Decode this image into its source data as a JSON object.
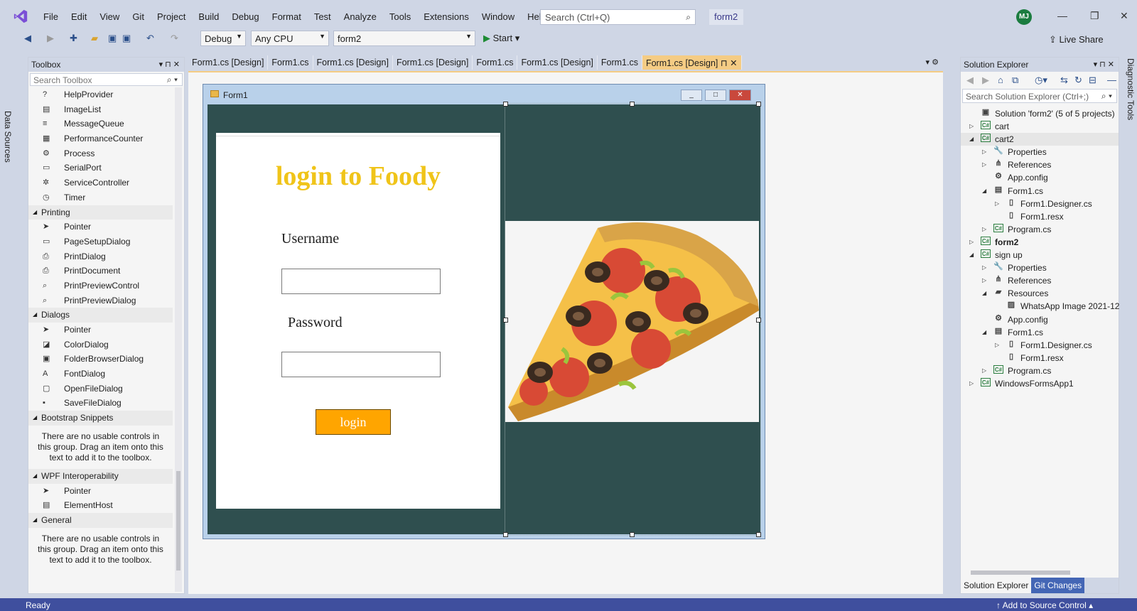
{
  "menu": [
    "File",
    "Edit",
    "View",
    "Git",
    "Project",
    "Build",
    "Debug",
    "Format",
    "Test",
    "Analyze",
    "Tools",
    "Extensions",
    "Window",
    "Help"
  ],
  "search_placeholder": "Search (Ctrl+Q)",
  "solution_badge": "form2",
  "avatar_initials": "MJ",
  "toolbar": {
    "config": "Debug",
    "platform": "Any CPU",
    "startup_project": "form2",
    "start_label": "Start",
    "live_share": "Live Share"
  },
  "left_strip_label": "Data Sources",
  "right_strip_label": "Diagnostic Tools",
  "toolbox": {
    "title": "Toolbox",
    "search_placeholder": "Search Toolbox",
    "items": [
      {
        "kind": "item",
        "label": "HelpProvider",
        "icon": "help-icon"
      },
      {
        "kind": "item",
        "label": "ImageList",
        "icon": "imagelist-icon"
      },
      {
        "kind": "item",
        "label": "MessageQueue",
        "icon": "queue-icon"
      },
      {
        "kind": "item",
        "label": "PerformanceCounter",
        "icon": "counter-icon"
      },
      {
        "kind": "item",
        "label": "Process",
        "icon": "process-icon"
      },
      {
        "kind": "item",
        "label": "SerialPort",
        "icon": "port-icon"
      },
      {
        "kind": "item",
        "label": "ServiceController",
        "icon": "gear-icon"
      },
      {
        "kind": "item",
        "label": "Timer",
        "icon": "timer-icon"
      },
      {
        "kind": "group",
        "label": "Printing"
      },
      {
        "kind": "item",
        "label": "Pointer",
        "icon": "pointer-icon"
      },
      {
        "kind": "item",
        "label": "PageSetupDialog",
        "icon": "page-icon"
      },
      {
        "kind": "item",
        "label": "PrintDialog",
        "icon": "printer-icon"
      },
      {
        "kind": "item",
        "label": "PrintDocument",
        "icon": "printer-icon"
      },
      {
        "kind": "item",
        "label": "PrintPreviewControl",
        "icon": "preview-icon"
      },
      {
        "kind": "item",
        "label": "PrintPreviewDialog",
        "icon": "preview-icon"
      },
      {
        "kind": "group",
        "label": "Dialogs"
      },
      {
        "kind": "item",
        "label": "Pointer",
        "icon": "pointer-icon"
      },
      {
        "kind": "item",
        "label": "ColorDialog",
        "icon": "color-icon"
      },
      {
        "kind": "item",
        "label": "FolderBrowserDialog",
        "icon": "folder-icon"
      },
      {
        "kind": "item",
        "label": "FontDialog",
        "icon": "font-icon"
      },
      {
        "kind": "item",
        "label": "OpenFileDialog",
        "icon": "open-icon"
      },
      {
        "kind": "item",
        "label": "SaveFileDialog",
        "icon": "save-icon"
      },
      {
        "kind": "group",
        "label": "Bootstrap Snippets"
      },
      {
        "kind": "note",
        "label": "There are no usable controls in this group. Drag an item onto this text to add it to the toolbox."
      },
      {
        "kind": "group",
        "label": "WPF Interoperability"
      },
      {
        "kind": "item",
        "label": "Pointer",
        "icon": "pointer-icon"
      },
      {
        "kind": "item",
        "label": "ElementHost",
        "icon": "host-icon"
      },
      {
        "kind": "group",
        "label": "General"
      },
      {
        "kind": "note",
        "label": "There are no usable controls in this group. Drag an item onto this text to add it to the toolbox."
      }
    ]
  },
  "doc_tabs": [
    {
      "label": "Form1.cs [Design]",
      "active": false
    },
    {
      "label": "Form1.cs",
      "active": false
    },
    {
      "label": "Form1.cs [Design]",
      "active": false
    },
    {
      "label": "Form1.cs [Design]",
      "active": false
    },
    {
      "label": "Form1.cs",
      "active": false
    },
    {
      "label": "Form1.cs [Design]",
      "active": false
    },
    {
      "label": "Form1.cs",
      "active": false
    },
    {
      "label": "Form1.cs [Design]",
      "active": true
    }
  ],
  "form": {
    "title": "Form1",
    "heading": "login to Foody",
    "username_label": "Username",
    "password_label": "Password",
    "login_button": "login"
  },
  "solution_explorer": {
    "title": "Solution Explorer",
    "search_placeholder": "Search Solution Explorer (Ctrl+;)",
    "nodes": [
      {
        "label": "Solution 'form2' (5 of 5 projects)",
        "depth": 0,
        "twisty": "",
        "icon": "solution"
      },
      {
        "label": "cart",
        "depth": 0,
        "twisty": "▷",
        "icon": "cs"
      },
      {
        "label": "cart2",
        "depth": 0,
        "twisty": "◢",
        "icon": "cs",
        "selected": true
      },
      {
        "label": "Properties",
        "depth": 1,
        "twisty": "▷",
        "icon": "wrench"
      },
      {
        "label": "References",
        "depth": 1,
        "twisty": "▷",
        "icon": "refs"
      },
      {
        "label": "App.config",
        "depth": 1,
        "twisty": "",
        "icon": "config"
      },
      {
        "label": "Form1.cs",
        "depth": 1,
        "twisty": "◢",
        "icon": "form"
      },
      {
        "label": "Form1.Designer.cs",
        "depth": 2,
        "twisty": "▷",
        "icon": "file"
      },
      {
        "label": "Form1.resx",
        "depth": 2,
        "twisty": "",
        "icon": "file"
      },
      {
        "label": "Program.cs",
        "depth": 1,
        "twisty": "▷",
        "icon": "cs"
      },
      {
        "label": "form2",
        "depth": 0,
        "twisty": "▷",
        "icon": "cs",
        "bold": true
      },
      {
        "label": "sign up",
        "depth": 0,
        "twisty": "◢",
        "icon": "cs"
      },
      {
        "label": "Properties",
        "depth": 1,
        "twisty": "▷",
        "icon": "wrench"
      },
      {
        "label": "References",
        "depth": 1,
        "twisty": "▷",
        "icon": "refs"
      },
      {
        "label": "Resources",
        "depth": 1,
        "twisty": "◢",
        "icon": "folder"
      },
      {
        "label": "WhatsApp Image 2021-12",
        "depth": 2,
        "twisty": "",
        "icon": "image"
      },
      {
        "label": "App.config",
        "depth": 1,
        "twisty": "",
        "icon": "config"
      },
      {
        "label": "Form1.cs",
        "depth": 1,
        "twisty": "◢",
        "icon": "form"
      },
      {
        "label": "Form1.Designer.cs",
        "depth": 2,
        "twisty": "▷",
        "icon": "file"
      },
      {
        "label": "Form1.resx",
        "depth": 2,
        "twisty": "",
        "icon": "file"
      },
      {
        "label": "Program.cs",
        "depth": 1,
        "twisty": "▷",
        "icon": "cs"
      },
      {
        "label": "WindowsFormsApp1",
        "depth": 0,
        "twisty": "▷",
        "icon": "cs"
      }
    ],
    "bottom_tabs": [
      "Solution Explorer",
      "Git Changes"
    ]
  },
  "status": {
    "ready": "Ready",
    "source_control": "Add to Source Control"
  },
  "colors": {
    "accent_tab": "#f5cc84",
    "form_back": "#2f4f4f",
    "login_button": "#ffa500",
    "heading": "#f0c419",
    "status_bar": "#3f4f9e"
  }
}
